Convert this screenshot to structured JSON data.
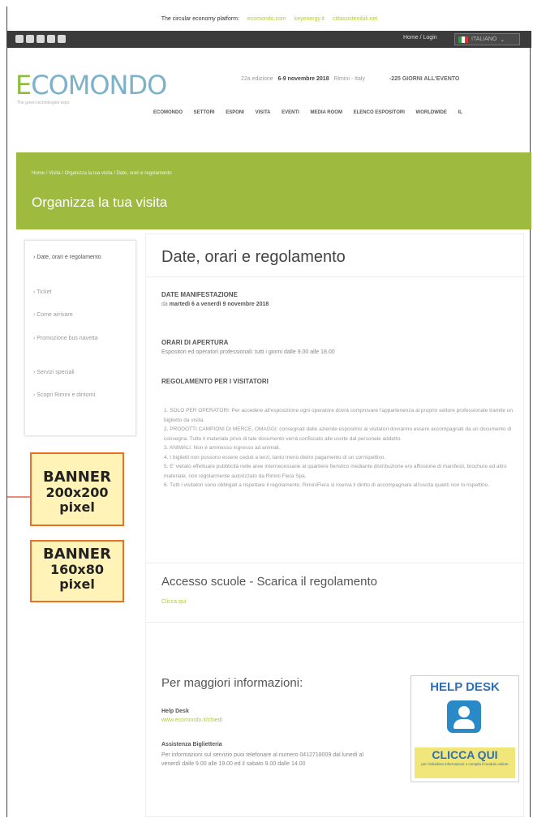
{
  "top_bar": {
    "label": "The circular economy platform:",
    "links": [
      "ecomondo.com",
      "keyenergy.it",
      "cittasostenibili.net"
    ]
  },
  "header": {
    "signin": "Home / Login",
    "language": "ITALIANO",
    "logo": {
      "e": "E",
      "rest": "COMONDO",
      "tagline": "The green technologies expo"
    },
    "edition": {
      "text": "22a edizione",
      "dates": "6-9 novembre 2018",
      "place": "Rimini - Italy",
      "days_left": "-225 GIORNI ALL'EVENTO"
    },
    "nav": [
      "ECOMONDO",
      "SETTORI",
      "ESPONI",
      "VISITA",
      "EVENTI",
      "MEDIA ROOM",
      "ELENCO ESPOSITORI",
      "WORLDWIDE",
      "IL"
    ]
  },
  "hero": {
    "breadcrumb": "Home / Visita / Organizza la tua visita / Date, orari e regolamento",
    "title": "Organizza la tua visita"
  },
  "sidebar": {
    "items": [
      "Date, orari e regolamento",
      "Ticket",
      "Come arrivare",
      "Promozione bus navetta",
      "Servizi speciali",
      "Scopri Rimini e dintorni"
    ]
  },
  "content": {
    "title": "Date, orari e regolamento",
    "dates_heading": "DATE MANIFESTAZIONE",
    "dates_prefix": "da",
    "dates_text": "martedì 6 a venerdì 9 novembre 2018",
    "hours_heading": "ORARI DI APERTURA",
    "hours_text": "Espositori ed operatori professionali: tutti i giorni dalle 9.00 alle 18.00",
    "rules_heading": "REGOLAMENTO PER I VISITATORI",
    "rules": [
      "1. SOLO PER OPERATORI: Per accedere all'esposizione ogni operatore dovrà comprovare l'appartenenza al proprio settore professionale tramite un biglietto da visita.",
      "2. PRODOTTI CAMPIONI DI MERCE, OMAGGI: consegnati dalle aziende espositrici ai visitatori dovranno essere accompagnati da un documento di consegna. Tutto il materiale privo di tale documento verrà confiscato alle uscite dal personale addetto.",
      "3. ANIMALI: Non è ammesso ingresso ad animali.",
      "4. I biglietti non possono essere ceduti a terzi, tanto meno dietro pagamento di un corrispettivo.",
      "5. E' vietato effettuare pubblicità nelle aree internecessarie al quartiere fieristico mediante distribuzione e/o affissione di manifesti, brochure ed altro materiale, non regolarmente autorizzato da Rimini Fiera Spa.",
      "6. Tutti i visitatori sono obbligati a rispettare il regolamento. RiminiFiera si riserva il diritto di accompagnare all'uscita quanti non lo rispettino."
    ],
    "schools_heading": "Accesso scuole - Scarica il regolamento",
    "schools_link": "Clicca qui",
    "info_heading": "Per maggiori informazioni:",
    "helpdesk_label": "Help Desk",
    "helpdesk_link": "www.ecomondo.it/chiedi",
    "ticket_label": "Assistenza Biglietteria",
    "ticket_text": "Per informazioni sul servizio puoi telefonare al numero 0412718009 dal lunedì al venerdì dalle 9.00 alle 19.00 ed il sabato 9.00 dalle 14.00"
  },
  "help_desk": {
    "title": "HELP DESK",
    "cta": "CLICCA QUI",
    "cta_sub": "per richiedere informazioni o compila il modulo online!"
  },
  "banners": [
    {
      "title": "BANNER",
      "size": "200x200",
      "unit": "pixel"
    },
    {
      "title": "BANNER",
      "size": "160x80",
      "unit": "pixel"
    }
  ]
}
